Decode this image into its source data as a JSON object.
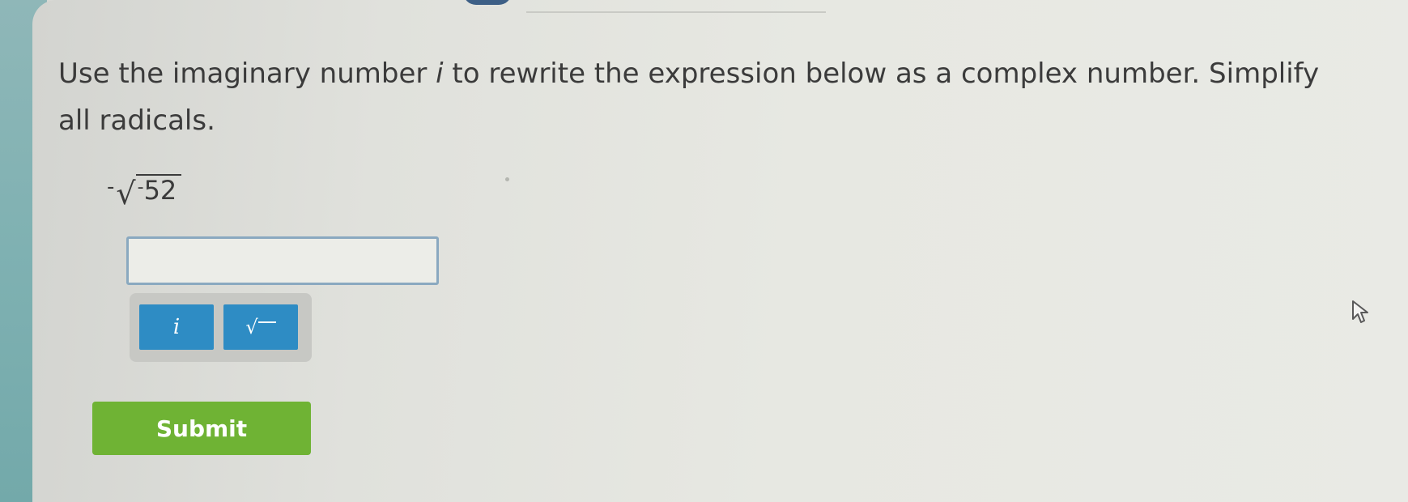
{
  "question": {
    "prompt_before_var": "Use the imaginary number ",
    "variable": "i",
    "prompt_after_var": " to rewrite the expression below as a complex number. Simplify all radicals."
  },
  "expression": {
    "outer_sign": "-",
    "radical_symbol": "√",
    "radicand_sign": "-",
    "radicand_value": "52"
  },
  "answer": {
    "value": "",
    "placeholder": ""
  },
  "keypad": {
    "i_label": "i",
    "sqrt_label": "√"
  },
  "submit": {
    "label": "Submit"
  },
  "colors": {
    "key_blue": "#2e8cc4",
    "submit_green": "#6fb334",
    "answer_border": "#8aa9c0"
  },
  "icons": {
    "cursor": "mouse-pointer-icon"
  }
}
